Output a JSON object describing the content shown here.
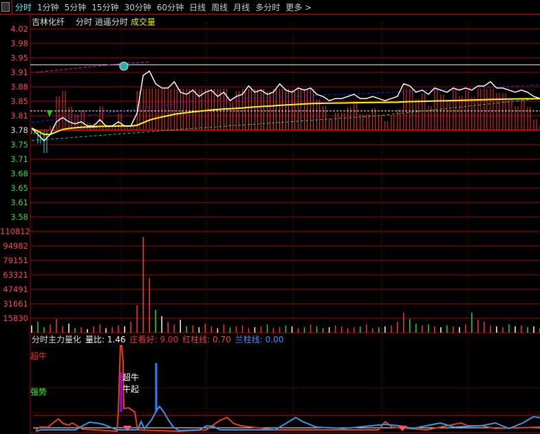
{
  "tabs": [
    "分时",
    "1分钟",
    "5分钟",
    "15分钟",
    "30分钟",
    "60分钟",
    "日线",
    "周线",
    "月线",
    "多分时",
    "更多 >"
  ],
  "title": {
    "stock": "吉林化纤",
    "mode": "分时",
    "indicator": "逍遥分时",
    "volume": "成交量"
  },
  "price_axis": [
    "4.02",
    "3.98",
    "3.95",
    "3.91",
    "3.88",
    "3.85",
    "3.81",
    "3.78",
    "3.75",
    "3.71",
    "3.68",
    "3.65",
    "3.61",
    "3.58"
  ],
  "volume_axis": [
    "110812",
    "94982",
    "79151",
    "63321",
    "47491",
    "31661",
    "15830"
  ],
  "indicator": {
    "name": "分时主力量化",
    "ratio_label": "量比:",
    "ratio": "1.46",
    "zkh_label": "庄看好:",
    "zkh": "9.00",
    "red_label": "红柱线:",
    "red": "0.70",
    "blue_label": "兰柱线:",
    "blue": "0.00",
    "level_super": "超牛",
    "level_strong": "强势",
    "signal1": "超牛",
    "signal2": "牛起"
  },
  "colors": {
    "up": "#ff3030",
    "down": "#33dddd",
    "avg": "#ffff00",
    "grid": "#b00000"
  },
  "chart_data": {
    "type": "line",
    "prev_close": 3.78,
    "ylim": [
      3.58,
      4.02
    ],
    "price": [
      3.785,
      3.77,
      3.755,
      3.77,
      3.8,
      3.81,
      3.8,
      3.795,
      3.8,
      3.79,
      3.79,
      3.805,
      3.79,
      3.79,
      3.8,
      3.79,
      3.79,
      3.82,
      3.91,
      3.92,
      3.89,
      3.88,
      3.88,
      3.895,
      3.87,
      3.865,
      3.875,
      3.86,
      3.87,
      3.875,
      3.86,
      3.87,
      3.85,
      3.86,
      3.865,
      3.885,
      3.87,
      3.875,
      3.865,
      3.87,
      3.89,
      3.875,
      3.87,
      3.88,
      3.875,
      3.88,
      3.865,
      3.86,
      3.85,
      3.855,
      3.855,
      3.86,
      3.865,
      3.855,
      3.855,
      3.86,
      3.855,
      3.85,
      3.855,
      3.86,
      3.89,
      3.885,
      3.87,
      3.875,
      3.865,
      3.88,
      3.875,
      3.87,
      3.88,
      3.875,
      3.88,
      3.875,
      3.885,
      3.885,
      3.895,
      3.88,
      3.88,
      3.875,
      3.87,
      3.875,
      3.87,
      3.86,
      3.855
    ],
    "volume": [
      8000,
      12000,
      6000,
      9000,
      15000,
      7000,
      10000,
      5000,
      6000,
      4000,
      7000,
      9000,
      5000,
      6000,
      8000,
      7000,
      12000,
      30000,
      105000,
      60000,
      25000,
      18000,
      12000,
      9000,
      14000,
      7000,
      8000,
      6000,
      10000,
      7000,
      5000,
      9000,
      6000,
      7000,
      8000,
      5000,
      6000,
      7000,
      9000,
      5000,
      6000,
      8000,
      7000,
      5000,
      6000,
      9000,
      7000,
      5000,
      6000,
      8000,
      7000,
      5000,
      6000,
      7000,
      9000,
      5000,
      6000,
      7000,
      8000,
      12000,
      22000,
      15000,
      10000,
      8000,
      9000,
      7000,
      6000,
      8000,
      7000,
      6000,
      9000,
      22000,
      14000,
      12000,
      8000,
      7000,
      6000,
      9000,
      7000,
      8000,
      6000,
      7000,
      5000
    ]
  }
}
